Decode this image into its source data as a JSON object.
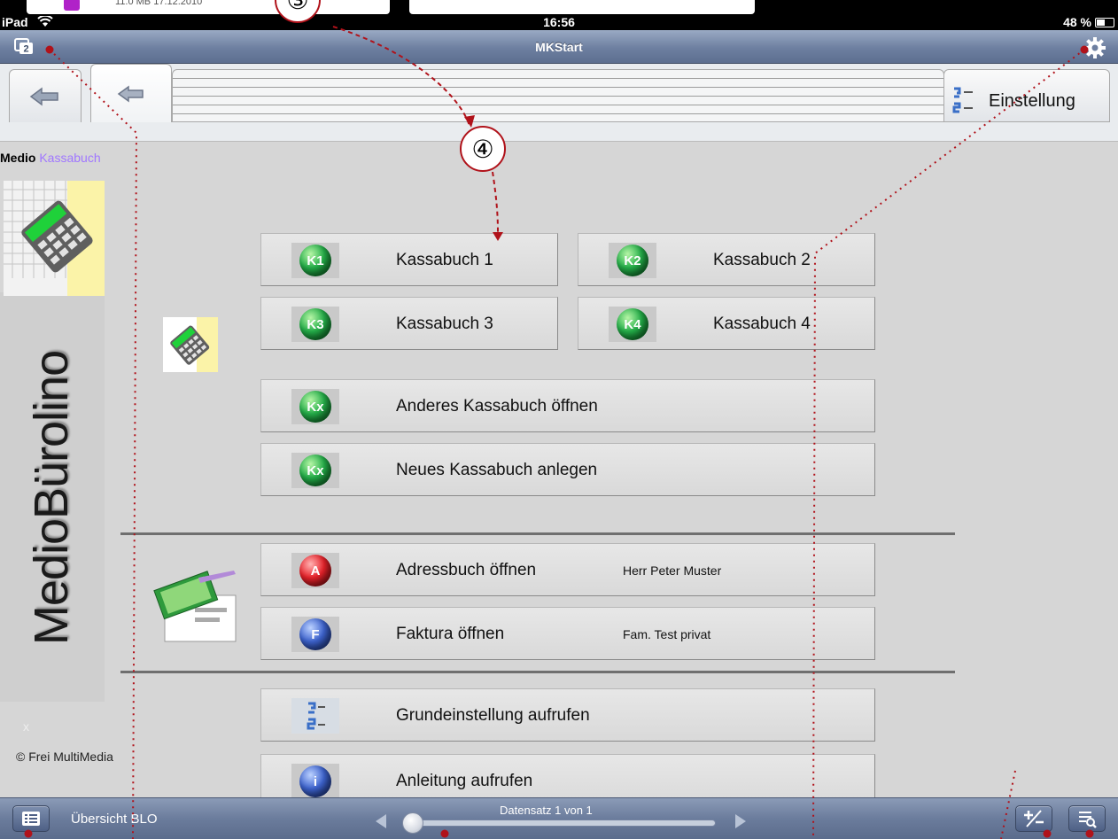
{
  "background_strip": {
    "file_meta": "11.0 MB   17.12.2010"
  },
  "status_bar": {
    "device": "iPad",
    "time": "16:56",
    "battery": "48 %"
  },
  "nav_bar": {
    "title": "MKStart",
    "windows_count": "2"
  },
  "tabs": {
    "settings_label": "Einstellung"
  },
  "brand": {
    "name_part1": "Medio",
    "name_part2": "Kassabuch",
    "vertical_text": "MedioBürolino",
    "x_mark": "x",
    "copyright": "© Frei MultiMedia"
  },
  "menu": {
    "kassabuch_1": {
      "badge": "K1",
      "label": "Kassabuch 1"
    },
    "kassabuch_2": {
      "badge": "K2",
      "label": "Kassabuch 2"
    },
    "kassabuch_3": {
      "badge": "K3",
      "label": "Kassabuch 3"
    },
    "kassabuch_4": {
      "badge": "K4",
      "label": "Kassabuch 4"
    },
    "other": {
      "badge": "Kx",
      "label": "Anderes Kassabuch öffnen"
    },
    "new": {
      "badge": "Kx",
      "label": "Neues Kassabuch anlegen"
    },
    "address": {
      "badge": "A",
      "label": "Adressbuch öffnen",
      "sub": "Herr Peter Muster"
    },
    "faktura": {
      "badge": "F",
      "label": "Faktura öffnen",
      "sub": "Fam. Test privat"
    },
    "grund": {
      "label": "Grundeinstellung aufrufen"
    },
    "anleitung": {
      "badge": "i",
      "label": "Anleitung aufrufen"
    }
  },
  "bottom_bar": {
    "overview_label": "Übersicht BLO",
    "record_label": "Datensatz 1 von 1",
    "slider_position": 0
  },
  "callouts": {
    "three": "③",
    "four": "④"
  },
  "colors": {
    "annotation": "#b0121a",
    "accent_brand": "#a077ff",
    "nav_blue": "#6d7fa0"
  }
}
